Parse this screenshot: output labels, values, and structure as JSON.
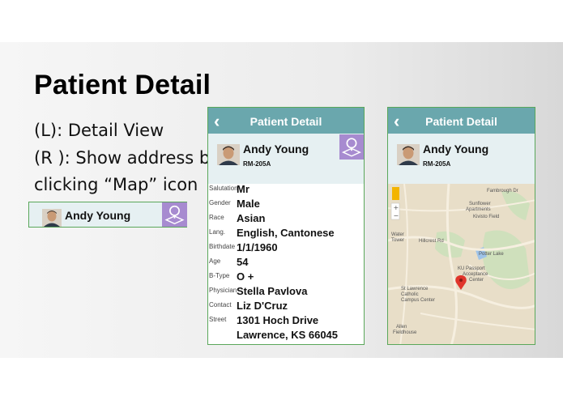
{
  "slide": {
    "title": "Patient Detail",
    "lines": [
      "(L): Detail View",
      "(R ): Show address by",
      "clicking “Map” icon"
    ]
  },
  "mini_card": {
    "name": "Andy Young"
  },
  "left_phone": {
    "header": "Patient Detail",
    "patient_name": "Andy Young",
    "room": "RM-205A",
    "fields": [
      {
        "label": "Salutation",
        "value": "Mr"
      },
      {
        "label": "Gender",
        "value": "Male"
      },
      {
        "label": "Race",
        "value": "Asian"
      },
      {
        "label": "Lang.",
        "value": "English, Cantonese"
      },
      {
        "label": "Birthdate",
        "value": "1/1/1960"
      },
      {
        "label": "Age",
        "value": "54"
      },
      {
        "label": "B-Type",
        "value": "O +"
      },
      {
        "label": "Physician",
        "value": "Stella Pavlova"
      },
      {
        "label": "Contact",
        "value": "Liz D'Cruz"
      },
      {
        "label": "Street",
        "value": "1301 Hoch Drive"
      },
      {
        "label": "",
        "value": "Lawrence, KS 66045"
      }
    ]
  },
  "right_phone": {
    "header": "Patient Detail",
    "patient_name": "Andy Young",
    "room": "RM-205A",
    "map_labels": {
      "fambrough": "Fambrough Dr",
      "sunflower": "Sunflower",
      "apartments": "Apartments",
      "kivisto": "Kivisto Field",
      "hillcrest": "Hillcrest Rd",
      "water": "Water",
      "tower": "Tower",
      "potter": "Potter Lake",
      "kupassport": "KU Passport",
      "acceptance": "Acceptance",
      "center": "Center",
      "stlawrence": "St Lawrence",
      "catholic": "Catholic",
      "campus": "Campus Center",
      "allen": "Allen",
      "fieldhouse": "Fieldhouse"
    }
  },
  "icons": {
    "back": "‹",
    "zoom_in": "+",
    "zoom_out": "−"
  },
  "colors": {
    "header": "#6aa7ad",
    "card": "#e6f0f2",
    "map_button": "#a78bd0",
    "border": "#5aa75a",
    "pin": "#e0352b"
  }
}
